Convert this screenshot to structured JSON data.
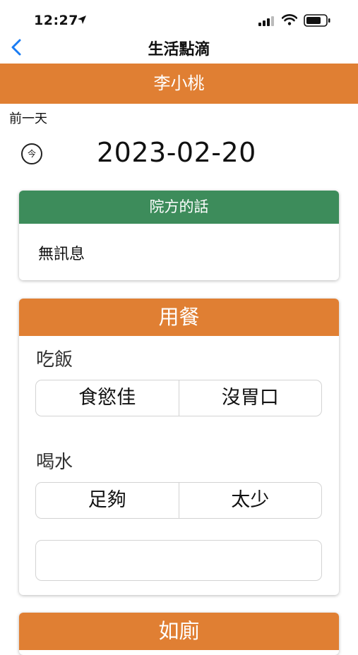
{
  "status_bar": {
    "time": "12:27"
  },
  "nav": {
    "title": "生活點滴"
  },
  "resident": {
    "name": "李小桃"
  },
  "date_nav": {
    "prev_label": "前一天",
    "today_label": "今",
    "date": "2023-02-20"
  },
  "message_card": {
    "title": "院方的話",
    "body": "無訊息"
  },
  "meal_card": {
    "title": "用餐",
    "eat": {
      "label": "吃飯",
      "options": [
        "食慾佳",
        "沒胃口"
      ]
    },
    "drink": {
      "label": "喝水",
      "options": [
        "足夠",
        "太少"
      ]
    },
    "note_value": ""
  },
  "toilet_card": {
    "title": "如廁"
  },
  "colors": {
    "orange": "#e07f33",
    "green": "#3d8c5b",
    "ios_blue": "#1a7cf3"
  }
}
